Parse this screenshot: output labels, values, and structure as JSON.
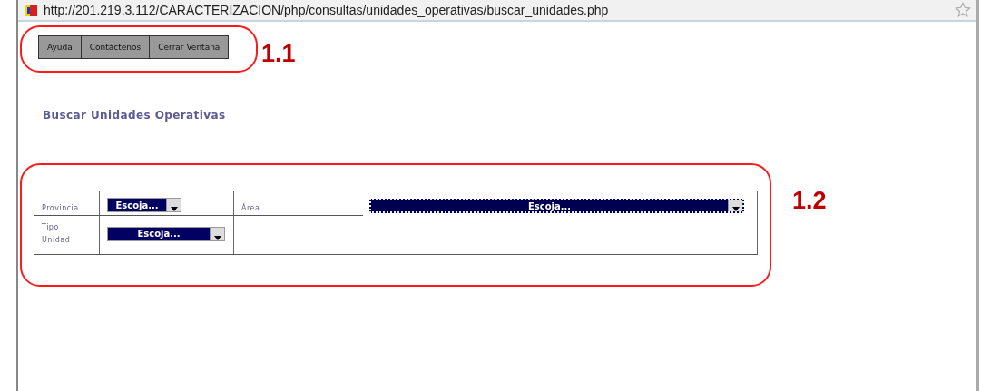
{
  "address_bar": {
    "url": "http://201.219.3.112/CARACTERIZACION/php/consultas/unidades_operativas/buscar_unidades.php"
  },
  "toolbar": {
    "buttons": [
      "Ayuda",
      "Contáctenos",
      "Cerrar Ventana"
    ]
  },
  "page_title": "Buscar Unidades Operativas",
  "form": {
    "fields": [
      {
        "label": "Provincia",
        "value": "Escoja...",
        "focused": false
      },
      {
        "label": "Área",
        "value": "Escoja...",
        "focused": true
      },
      {
        "label": "Tipo Unidad",
        "value": "Escoja...",
        "focused": false
      }
    ]
  },
  "annotations": [
    {
      "label": "1.1",
      "kind": "toolbar"
    },
    {
      "label": "1.2",
      "kind": "form"
    }
  ]
}
